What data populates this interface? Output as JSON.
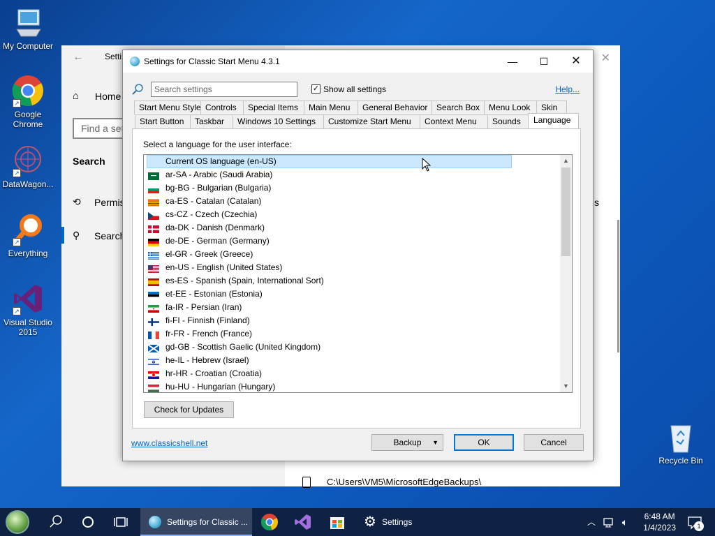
{
  "desktop": {
    "icons": [
      {
        "label": "My Computer"
      },
      {
        "label": "Google Chrome"
      },
      {
        "label": "DataWagon..."
      },
      {
        "label": "Everything"
      },
      {
        "label": "Visual Studio 2015"
      },
      {
        "label": "Recycle Bin"
      }
    ]
  },
  "background_window": {
    "title": "Setti",
    "nav": {
      "home": "Home",
      "find_placeholder": "Find a set",
      "search_heading": "Search",
      "permissions": "Permis",
      "search": "Search"
    },
    "path": "C:\\Users\\VM5\\MicrosoftEdgeBackups\\",
    "truncated_s": "s"
  },
  "dialog": {
    "title": "Settings for Classic Start Menu 4.3.1",
    "search_placeholder": "Search settings",
    "show_all_label": "Show all settings",
    "show_all_checked": true,
    "help_label": "Help...",
    "tabs_row1": [
      "Start Menu Style",
      "Controls",
      "Special Items",
      "Main Menu",
      "General Behavior",
      "Search Box",
      "Menu Look",
      "Skin"
    ],
    "tabs_row2": [
      "Start Button",
      "Taskbar",
      "Windows 10 Settings",
      "Customize Start Menu",
      "Context Menu",
      "Sounds",
      "Language"
    ],
    "active_tab": "Language",
    "language_prompt": "Select a language for the user interface:",
    "languages": [
      {
        "label": "Current OS language (en-US)",
        "flag": "none",
        "selected": true
      },
      {
        "label": "ar-SA - Arabic (Saudi Arabia)",
        "flag": "sa"
      },
      {
        "label": "bg-BG - Bulgarian (Bulgaria)",
        "flag": "bg"
      },
      {
        "label": "ca-ES - Catalan (Catalan)",
        "flag": "ca"
      },
      {
        "label": "cs-CZ - Czech (Czechia)",
        "flag": "cz"
      },
      {
        "label": "da-DK - Danish (Denmark)",
        "flag": "dk"
      },
      {
        "label": "de-DE - German (Germany)",
        "flag": "de"
      },
      {
        "label": "el-GR - Greek (Greece)",
        "flag": "gr"
      },
      {
        "label": "en-US - English (United States)",
        "flag": "us"
      },
      {
        "label": "es-ES - Spanish (Spain, International Sort)",
        "flag": "es"
      },
      {
        "label": "et-EE - Estonian (Estonia)",
        "flag": "ee"
      },
      {
        "label": "fa-IR - Persian (Iran)",
        "flag": "ir"
      },
      {
        "label": "fi-FI - Finnish (Finland)",
        "flag": "fi"
      },
      {
        "label": "fr-FR - French (France)",
        "flag": "fr"
      },
      {
        "label": "gd-GB - Scottish Gaelic (United Kingdom)",
        "flag": "gb"
      },
      {
        "label": "he-IL - Hebrew (Israel)",
        "flag": "il"
      },
      {
        "label": "hr-HR - Croatian (Croatia)",
        "flag": "hr"
      },
      {
        "label": "hu-HU - Hungarian (Hungary)",
        "flag": "hu"
      }
    ],
    "check_updates_label": "Check for Updates",
    "website_link": "www.classicshell.net",
    "backup_label": "Backup",
    "ok_label": "OK",
    "cancel_label": "Cancel"
  },
  "taskbar": {
    "classic_shell_app": "Settings for Classic ...",
    "settings_app": "Settings",
    "time": "6:48 AM",
    "date": "1/4/2023",
    "notification_count": "1"
  },
  "colors": {
    "accent": "#0078d7",
    "selection": "#cce8ff",
    "link": "#0066cc",
    "taskbar": "#0f2244"
  }
}
